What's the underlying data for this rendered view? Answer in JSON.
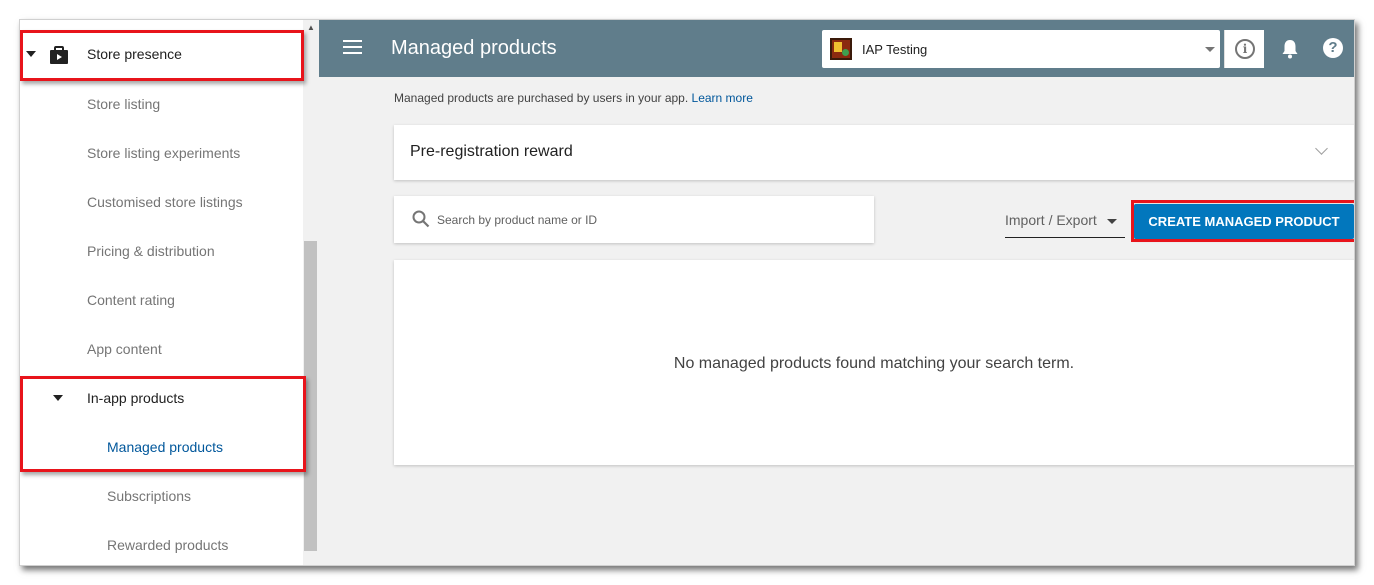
{
  "sidebar": {
    "items": [
      {
        "label": "Store presence"
      },
      {
        "label": "Store listing"
      },
      {
        "label": "Store listing experiments"
      },
      {
        "label": "Customised store listings"
      },
      {
        "label": "Pricing & distribution"
      },
      {
        "label": "Content rating"
      },
      {
        "label": "App content"
      },
      {
        "label": "In-app products"
      },
      {
        "label": "Managed products"
      },
      {
        "label": "Subscriptions"
      },
      {
        "label": "Rewarded products"
      }
    ]
  },
  "header": {
    "title": "Managed products",
    "app_selector": {
      "value": "IAP Testing"
    },
    "info_symbol": "i",
    "help_symbol": "?"
  },
  "main": {
    "intro_text": "Managed products are purchased by users in your app.",
    "learn_more": "Learn more",
    "prereg_title": "Pre-registration reward",
    "search_placeholder": "Search by product name or ID",
    "import_export": "Import / Export",
    "create_button": "CREATE MANAGED PRODUCT",
    "empty_message": "No managed products found matching your search term."
  },
  "colors": {
    "header_bg": "#607d8b",
    "accent": "#0277bd",
    "link": "#01579b",
    "highlight": "#e8141b"
  }
}
